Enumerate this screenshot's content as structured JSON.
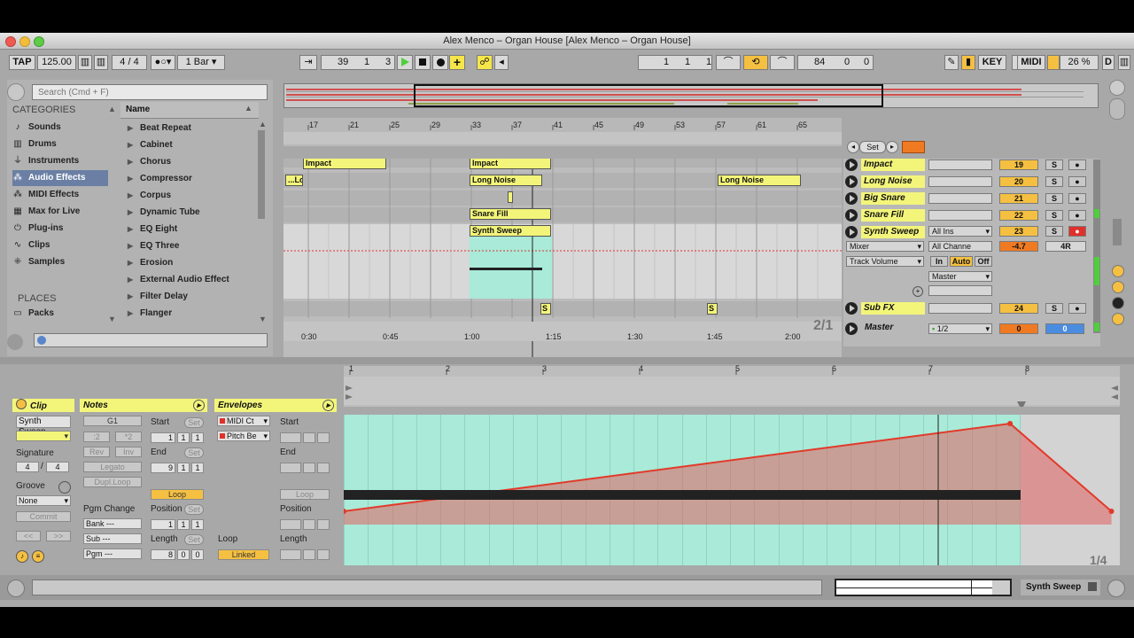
{
  "window": {
    "title": "Alex Menco – Organ House  [Alex Menco – Organ House]"
  },
  "transport": {
    "tap_label": "TAP",
    "tempo": "125.00",
    "signature": "4 / 4",
    "quantize": "1 Bar",
    "position_bar": "39",
    "position_beat": "1",
    "position_sixteenth": "3",
    "loop_start_bar": "1",
    "loop_start_beat": "1",
    "loop_start_sixteenth": "1",
    "loop_length_bar": "84",
    "loop_length_beat": "0",
    "loop_length_sixteenth": "0",
    "key_label": "KEY",
    "midi_label": "MIDI",
    "cpu": "26 %",
    "d_label": "D"
  },
  "browser": {
    "search_placeholder": "Search (Cmd + F)",
    "categories_title": "CATEGORIES",
    "categories": [
      {
        "label": "Sounds",
        "icon": "♪"
      },
      {
        "label": "Drums",
        "icon": "▥"
      },
      {
        "label": "Instruments",
        "icon": "⏚"
      },
      {
        "label": "Audio Effects",
        "icon": "⁂"
      },
      {
        "label": "MIDI Effects",
        "icon": "⁂"
      },
      {
        "label": "Max for Live",
        "icon": "▦"
      },
      {
        "label": "Plug-ins",
        "icon": "⏻"
      },
      {
        "label": "Clips",
        "icon": "∿"
      },
      {
        "label": "Samples",
        "icon": "⁜"
      }
    ],
    "places_title": "PLACES",
    "places": [
      {
        "label": "Packs"
      }
    ],
    "name_header": "Name",
    "items": [
      "Beat Repeat",
      "Cabinet",
      "Chorus",
      "Compressor",
      "Corpus",
      "Dynamic Tube",
      "EQ Eight",
      "EQ Three",
      "Erosion",
      "External Audio Effect",
      "Filter Delay",
      "Flanger"
    ]
  },
  "arrangement": {
    "ruler_bars": [
      "17",
      "21",
      "25",
      "29",
      "33",
      "37",
      "41",
      "45",
      "49",
      "53",
      "57",
      "61",
      "65"
    ],
    "time_marks": [
      "0:30",
      "0:45",
      "1:00",
      "1:15",
      "1:30",
      "1:45",
      "2:00"
    ],
    "zoom_label": "2/1",
    "set_label": "Set",
    "clips": [
      {
        "label": "Impact"
      },
      {
        "label": "Impact"
      },
      {
        "label": "...Lo"
      },
      {
        "label": "Long Noise"
      },
      {
        "label": "Long Noise"
      },
      {
        "label": "Snare Fill"
      },
      {
        "label": "Synth Sweep"
      },
      {
        "label": "S"
      },
      {
        "label": "S"
      }
    ]
  },
  "tracks": [
    {
      "name": "Impact",
      "number": "19",
      "solo": "S"
    },
    {
      "name": "Long Noise",
      "number": "20",
      "solo": "S"
    },
    {
      "name": "Big Snare",
      "number": "21",
      "solo": "S"
    },
    {
      "name": "Snare Fill",
      "number": "22",
      "solo": "S"
    },
    {
      "name": "Synth Sweep",
      "number": "23",
      "solo": "S",
      "volume": "-4.7",
      "pan": "4R"
    },
    {
      "name": "Sub FX",
      "number": "24",
      "solo": "S"
    }
  ],
  "synth_sweep_controls": {
    "input_type": "All Ins",
    "input_channel": "All Channe",
    "device": "Mixer",
    "parameter": "Track Volume",
    "monitor_in": "In",
    "monitor_auto": "Auto",
    "monitor_off": "Off",
    "output": "Master"
  },
  "master": {
    "name": "Master",
    "quant": "1/2",
    "volume": "0",
    "pan": "0"
  },
  "clip_view": {
    "clip_header": "Clip",
    "clip_name": "Synth Sweep",
    "signature_label": "Signature",
    "sig_num": "4",
    "sig_den": "4",
    "groove_label": "Groove",
    "groove_value": "None",
    "commit_label": "Commit",
    "notes_header": "Notes",
    "note_value": "G1",
    "div2": ":2",
    "mul2": "*2",
    "rev": "Rev",
    "inv": "Inv",
    "legato": "Legato",
    "dupl_loop": "Dupl.Loop",
    "pgm_change_label": "Pgm Change",
    "bank": "Bank ---",
    "sub": "Sub ---",
    "pgm": "Pgm ---",
    "start_label": "Start",
    "start": [
      "1",
      "1",
      "1"
    ],
    "end_label": "End",
    "end": [
      "9",
      "1",
      "1"
    ],
    "loop_label": "Loop",
    "position_label": "Position",
    "position": [
      "1",
      "1",
      "1"
    ],
    "length_label": "Length",
    "length": [
      "8",
      "0",
      "0"
    ],
    "set_label": "Set",
    "envelopes_header": "Envelopes",
    "env_device": "MIDI Ct",
    "env_param": "Pitch Be",
    "env_start_label": "Start",
    "env_end_label": "End",
    "env_loop_label": "Loop",
    "env_position_label": "Position",
    "env_loop_label2": "Loop",
    "env_length_label": "Length",
    "linked_label": "Linked"
  },
  "editor": {
    "ruler_bars": [
      "1",
      "2",
      "3",
      "4",
      "5",
      "6",
      "7",
      "8"
    ],
    "zoom_label": "1/4",
    "envelope_points": [
      [
        1.0,
        0.1
      ],
      [
        7.9,
        1.0
      ],
      [
        8.95,
        0.1
      ]
    ]
  },
  "status_bar": {
    "track_name": "Synth Sweep"
  },
  "colors": {
    "clip_yellow": "#f3f57a",
    "accent_orange": "#f5c041",
    "envelope_red": "#e23a2a",
    "clip_bg": "#a9ead8"
  }
}
